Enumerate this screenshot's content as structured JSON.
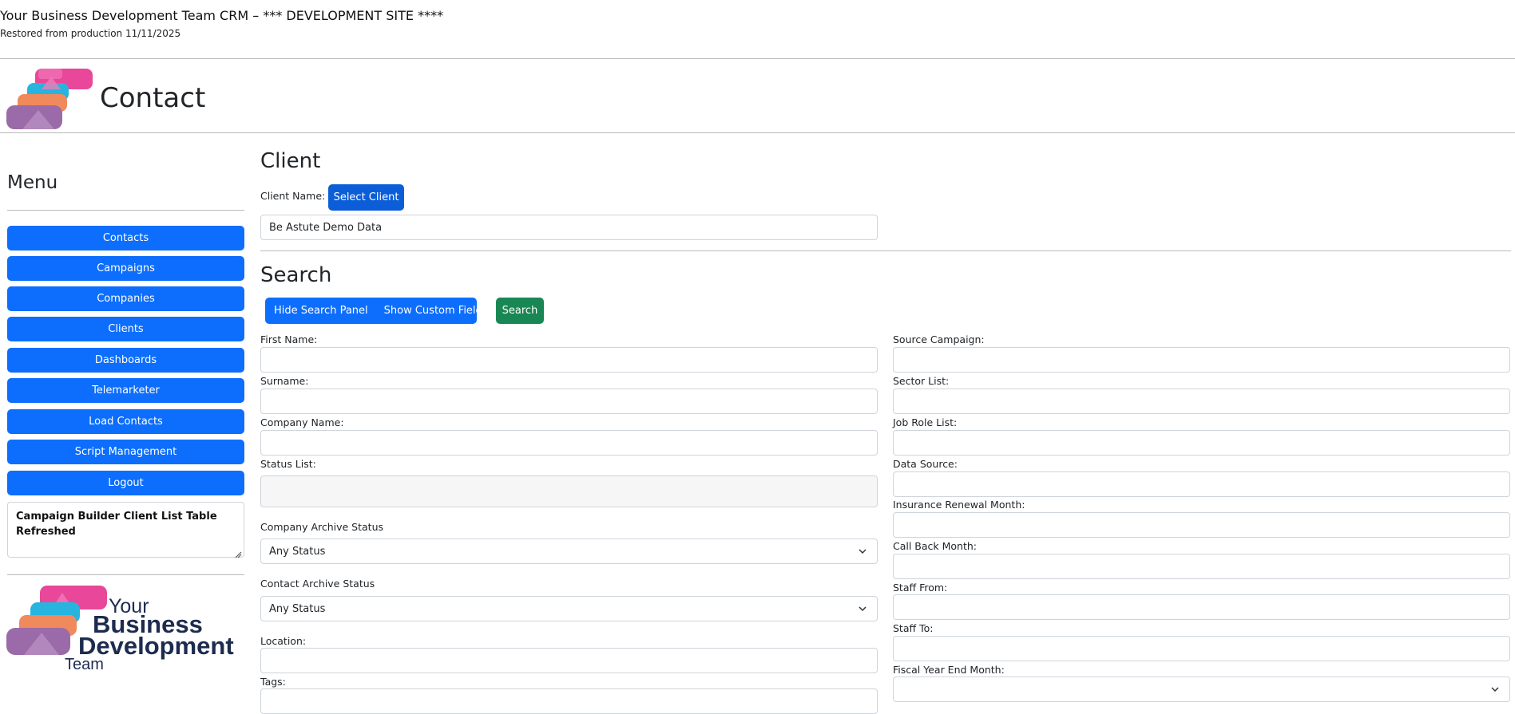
{
  "banner": {
    "title": "Your Business Development Team CRM – *** DEVELOPMENT SITE ****",
    "subtitle": "Restored from production 11/11/2025"
  },
  "header": {
    "page_title": "Contact"
  },
  "menu": {
    "title": "Menu",
    "items": [
      {
        "label": "Contacts"
      },
      {
        "label": "Campaigns"
      },
      {
        "label": "Companies"
      },
      {
        "label": "Clients"
      },
      {
        "label": "Dashboards"
      },
      {
        "label": "Telemarketer"
      },
      {
        "label": "Load Contacts"
      },
      {
        "label": "Script Management"
      },
      {
        "label": "Logout"
      }
    ],
    "notice_text": "Campaign Builder Client List Table Refreshed"
  },
  "brand_logo": {
    "line1": "Your",
    "line2": "Business",
    "line3": "Development",
    "line4": "Team"
  },
  "client": {
    "section_title": "Client",
    "name_label": "Client Name:",
    "select_button": "Select Client",
    "name_value": "Be Astute Demo Data"
  },
  "search": {
    "section_title": "Search",
    "hide_panel": "Hide Search Panel",
    "show_custom": "Show Custom Fields",
    "search_button": "Search",
    "left_fields": {
      "first_name": "First Name:",
      "surname": "Surname:",
      "company_name": "Company Name:",
      "status_list": "Status List:",
      "company_archive_status": "Company Archive Status",
      "company_archive_value": "Any Status",
      "contact_archive_status": "Contact Archive Status",
      "contact_archive_value": "Any Status",
      "location": "Location:",
      "tags": "Tags:"
    },
    "right_fields": {
      "source_campaign": "Source Campaign:",
      "sector_list": "Sector List:",
      "job_role_list": "Job Role List:",
      "data_source": "Data Source:",
      "insurance_renewal_month": "Insurance Renewal Month:",
      "call_back_month": "Call Back Month:",
      "staff_from": "Staff From:",
      "staff_to": "Staff To:",
      "fiscal_year_end_month": "Fiscal Year End Month:"
    }
  },
  "colors": {
    "primary": "#0d6efd",
    "primary_dark": "#0b5ed7",
    "success": "#198754",
    "logo_pink": "#e8479a",
    "logo_cyan": "#27b4df",
    "logo_orange": "#f08a5d",
    "logo_purple": "#9b6aa8",
    "logo_navy": "#1d2b4f"
  },
  "icons": {
    "dropdown": "chevron-down-icon",
    "resize": "resize-grip-icon"
  }
}
